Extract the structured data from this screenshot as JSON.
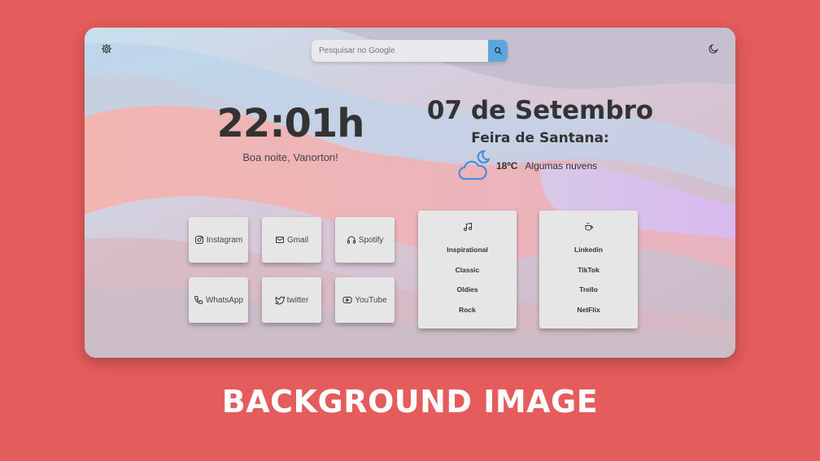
{
  "colors": {
    "page_background": "#e55c5c",
    "search_button": "#5aa7e0",
    "tile_background": "#e6e6e6",
    "text_dark": "#333333"
  },
  "header": {
    "settings_icon": "gear-icon",
    "theme_icon": "moon-icon",
    "search": {
      "placeholder": "Pesquisar no Google",
      "value": "",
      "button_icon": "search-icon"
    }
  },
  "clock": {
    "time": "22:01h",
    "greeting": "Boa noite, Vanorton!"
  },
  "weather": {
    "date": "07 de Setembro",
    "city": "Feira de Santana:",
    "icon": "cloud-moon-icon",
    "temperature": "18ºC",
    "description": "Algumas nuvens"
  },
  "shortcuts": [
    {
      "label": "Instagram",
      "icon": "instagram-icon"
    },
    {
      "label": "Gmail",
      "icon": "mail-icon"
    },
    {
      "label": "Spotify",
      "icon": "headphones-icon"
    },
    {
      "label": "WhatsApp",
      "icon": "phone-icon"
    },
    {
      "label": "twitter",
      "icon": "twitter-icon"
    },
    {
      "label": "YouTube",
      "icon": "youtube-icon"
    }
  ],
  "music_card": {
    "icon": "music-note-icon",
    "items": [
      "Inspirational",
      "Classic",
      "Oldies",
      "Rock"
    ]
  },
  "links_card": {
    "icon": "coffee-cup-icon",
    "items": [
      "Linkedin",
      "TikTok",
      "Trello",
      "NetFlix"
    ]
  },
  "caption": "BACKGROUND IMAGE"
}
